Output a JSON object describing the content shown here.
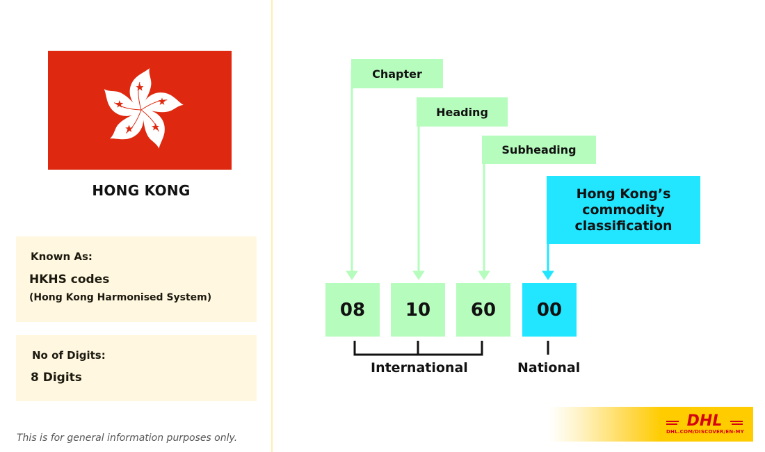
{
  "country": {
    "name": "HONG KONG",
    "flag_icon": "hong-kong-flag-bauhinia",
    "flag_colors": {
      "field": "#de2910",
      "flower": "#ffffff"
    }
  },
  "info": {
    "known_as": {
      "label": "Known As:",
      "value": "HKHS codes",
      "subtext": "(Hong Kong Harmonised System)"
    },
    "digits": {
      "label": "No of Digits:",
      "value": "8 Digits"
    }
  },
  "disclaimer": "This is for general information purposes only.",
  "diagram": {
    "labels": {
      "chapter": "Chapter",
      "heading": "Heading",
      "subheading": "Subheading",
      "national": "Hong Kong’s commodity classification"
    },
    "digits": [
      "08",
      "10",
      "60",
      "00"
    ],
    "groups": {
      "international": "International",
      "national": "National"
    },
    "colors": {
      "international": "#b6fcbd",
      "national": "#22e5ff"
    }
  },
  "brand": {
    "logo": "DHL",
    "url": "DHL.COM/DISCOVER/EN-MY",
    "colors": {
      "yellow": "#ffcc00",
      "red": "#d40511"
    }
  }
}
